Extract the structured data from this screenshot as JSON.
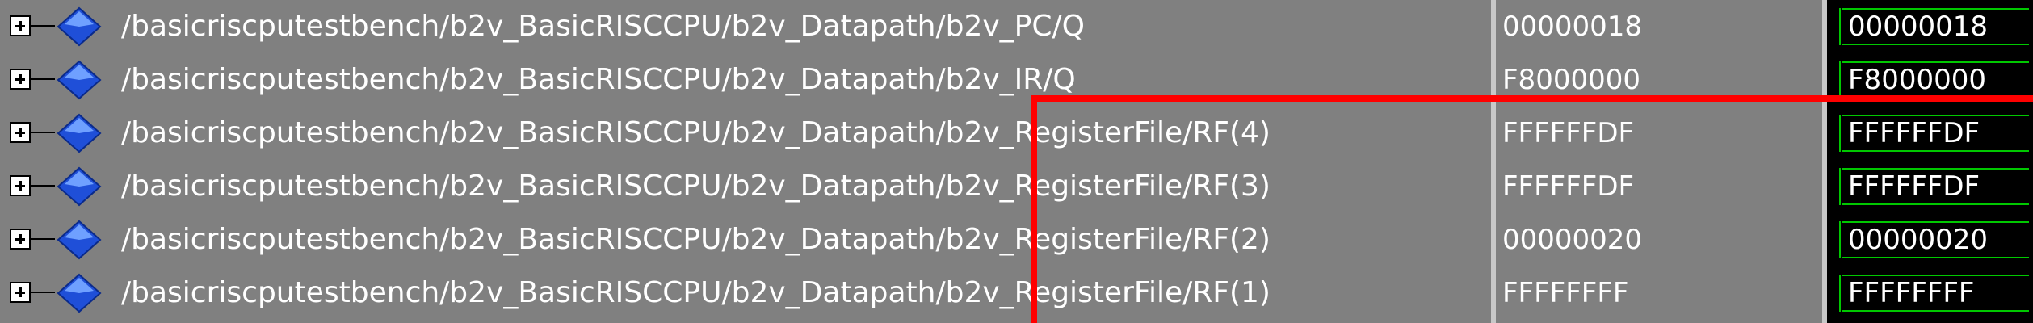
{
  "signals": [
    {
      "path": "/basicriscputestbench/b2v_BasicRISCCPU/b2v_Datapath/b2v_PC/Q",
      "value": "00000018",
      "wave_value": "00000018"
    },
    {
      "path": "/basicriscputestbench/b2v_BasicRISCCPU/b2v_Datapath/b2v_IR/Q",
      "value": "F8000000",
      "wave_value": "F8000000"
    },
    {
      "path": "/basicriscputestbench/b2v_BasicRISCCPU/b2v_Datapath/b2v_RegisterFile/RF(4)",
      "value": "FFFFFFDF",
      "wave_value": "FFFFFFDF"
    },
    {
      "path": "/basicriscputestbench/b2v_BasicRISCCPU/b2v_Datapath/b2v_RegisterFile/RF(3)",
      "value": "FFFFFFDF",
      "wave_value": "FFFFFFDF"
    },
    {
      "path": "/basicriscputestbench/b2v_BasicRISCCPU/b2v_Datapath/b2v_RegisterFile/RF(2)",
      "value": "00000020",
      "wave_value": "00000020"
    },
    {
      "path": "/basicriscputestbench/b2v_BasicRISCCPU/b2v_Datapath/b2v_RegisterFile/RF(1)",
      "value": "FFFFFFFF",
      "wave_value": "FFFFFFFF"
    }
  ],
  "icons": {
    "expander": "plus-expander-icon",
    "signal": "blue-diamond-signal-icon"
  },
  "colors": {
    "panel_bg": "#808080",
    "wave_bg": "#000000",
    "wave_line": "#00c800",
    "highlight": "#ff0000",
    "text": "#ffffff"
  }
}
